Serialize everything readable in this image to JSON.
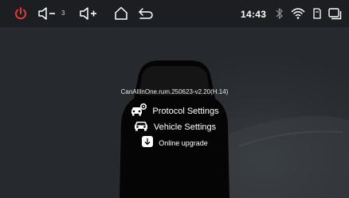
{
  "status_bar": {
    "icons": [
      "power-icon",
      "volume-down-icon",
      "volume-up-icon",
      "home-icon",
      "back-icon",
      "bluetooth-icon",
      "wifi-icon",
      "sd-card-icon",
      "recent-apps-icon"
    ],
    "volume_level": "3",
    "time": "14:43",
    "power_color": "#e53935"
  },
  "main": {
    "version": "CanAllInOne.rum.250623-v2.20(H.14)",
    "menu": [
      {
        "label": "Protocol Settings",
        "icon": "car-settings-icon"
      },
      {
        "label": "Vehicle Settings",
        "icon": "car-icon"
      },
      {
        "label": "Online upgrade",
        "icon": "download-icon"
      }
    ]
  }
}
